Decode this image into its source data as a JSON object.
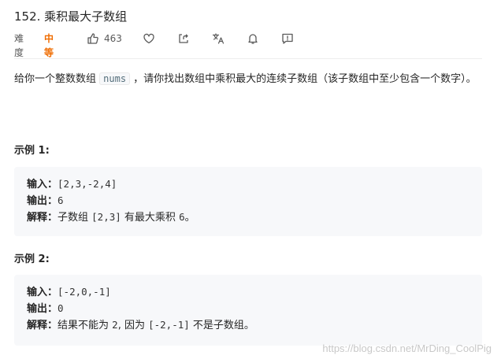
{
  "problem": {
    "title": "152. 乘积最大子数组",
    "difficulty_label": "难度",
    "difficulty_value": "中等",
    "likes": "463",
    "difficulty_color": "#ef6c00"
  },
  "toolbar": {
    "icons": [
      "thumbs-up-icon",
      "heart-icon",
      "share-icon",
      "translate-icon",
      "bell-icon",
      "feedback-icon"
    ]
  },
  "description": {
    "text_before": "给你一个整数数组 ",
    "code": "nums",
    "text_after": " ，请你找出数组中乘积最大的连续子数组（该子数组中至少包含一个数字）。"
  },
  "examples": [
    {
      "title": "示例 1:",
      "input_label": "输入：",
      "input_value": "[2,3,-2,4]",
      "output_label": "输出：",
      "output_value": "6",
      "explain_label": "解释：",
      "explain_text_1": "子数组 ",
      "explain_code_1": "[2,3]",
      "explain_text_2": " 有最大乘积 ",
      "explain_code_2": "6",
      "explain_text_3": "。",
      "explain_code_3": "",
      "explain_text_4": ""
    },
    {
      "title": "示例 2:",
      "input_label": "输入：",
      "input_value": "[-2,0,-1]",
      "output_label": "输出：",
      "output_value": "0",
      "explain_label": "解释：",
      "explain_text_1": "结果不能为 ",
      "explain_code_1": "2",
      "explain_text_2": ", 因为 ",
      "explain_code_2": "[-2,-1]",
      "explain_text_3": " 不是子数组。",
      "explain_code_3": "",
      "explain_text_4": ""
    }
  ],
  "watermark": "https://blog.csdn.net/MrDing_CoolPig"
}
